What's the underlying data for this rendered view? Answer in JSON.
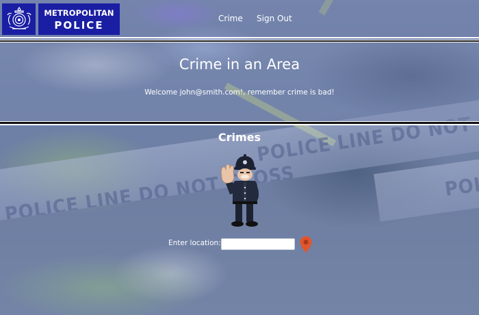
{
  "brand": {
    "line1": "METROPOLITAN",
    "line2": "POLICE",
    "color": "#1a1ea3"
  },
  "nav": {
    "crime": "Crime",
    "sign_out": "Sign Out"
  },
  "hero": {
    "title": "Crime in an Area",
    "welcome": "Welcome john@smith.com!, remember crime is bad!"
  },
  "crimes": {
    "title": "Crimes"
  },
  "background": {
    "tape_text": "POLICE LINE DO NOT CROSS",
    "tape_text_right": "POLICE LINE DO NOT CROSS",
    "tape_text_far": "POLICE"
  },
  "location": {
    "label": "Enter location:",
    "value": "",
    "placeholder": "",
    "pin_color": "#e0552c"
  },
  "icons": {
    "crest": "met-police-crest-icon",
    "officer": "police-officer-illustration",
    "pin": "map-pin-icon"
  }
}
